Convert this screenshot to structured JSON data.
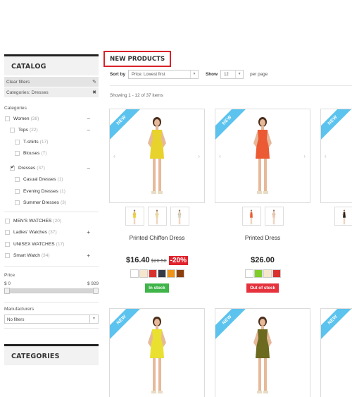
{
  "sidebar": {
    "catalog_title": "CATALOG",
    "clear_filters": "Clear filters",
    "clear_icon": "eraser-icon",
    "active_filter": "Categories: Dresses",
    "remove_icon": "close-icon",
    "categories_label": "Categories",
    "categories": [
      {
        "label": "Women",
        "count": "(38)",
        "level": 1,
        "checked": false,
        "toggle": "−"
      },
      {
        "label": "Tops",
        "count": "(22)",
        "level": 2,
        "checked": false,
        "toggle": "−"
      },
      {
        "label": "T-shirts",
        "count": "(17)",
        "level": 3,
        "checked": false,
        "toggle": ""
      },
      {
        "label": "Blouses",
        "count": "(7)",
        "level": 3,
        "checked": false,
        "toggle": ""
      },
      {
        "label": "Dresses",
        "count": "(37)",
        "level": 2,
        "checked": true,
        "toggle": "−"
      },
      {
        "label": "Casual Dresses",
        "count": "(1)",
        "level": 3,
        "checked": false,
        "toggle": ""
      },
      {
        "label": "Evening Dresses",
        "count": "(1)",
        "level": 3,
        "checked": false,
        "toggle": ""
      },
      {
        "label": "Summer Dresses",
        "count": "(3)",
        "level": 3,
        "checked": false,
        "toggle": ""
      },
      {
        "label": "MEN'S WATCHES",
        "count": "(20)",
        "level": 1,
        "checked": false,
        "toggle": ""
      },
      {
        "label": "Ladies' Watches",
        "count": "(37)",
        "level": 1,
        "checked": false,
        "toggle": "+"
      },
      {
        "label": "UNISEX WATCHES",
        "count": "(17)",
        "level": 1,
        "checked": false,
        "toggle": ""
      },
      {
        "label": "Smart Watch",
        "count": "(34)",
        "level": 1,
        "checked": false,
        "toggle": "+"
      }
    ],
    "price_label": "Price",
    "price_min": "$ 0",
    "price_max": "$ 929",
    "price_slider_range": [
      0,
      929
    ],
    "manufacturers_label": "Manufacturers",
    "manufacturers_value": "No filters",
    "categories_title": "CATEGORIES"
  },
  "main": {
    "title": "NEW PRODUCTS",
    "sort_label": "Sort by",
    "sort_value": "Price: Lowest first",
    "show_label": "Show",
    "show_value": "12",
    "per_page": "per page",
    "showing": "Showing 1 - 12 of 37 items",
    "badge": "NEW",
    "prev_icon": "‹",
    "next_icon": "›",
    "arrow_icon": "▼",
    "products": [
      {
        "name": "Printed Chiffon Dress",
        "price": "$16.40",
        "old_price": "$20.50",
        "reduction": "-20%",
        "colors": [
          "#ffffff",
          "#f5e6cc",
          "#d8312e",
          "#363a47",
          "#ef9419",
          "#8b3f0f"
        ],
        "stock": "In stock",
        "in_stock": true,
        "dress_color": "#e8d22c",
        "thumbs": [
          "#e8d22c",
          "#e6dca0",
          "#cfd6c8"
        ]
      },
      {
        "name": "Printed Dress",
        "price": "$26.00",
        "old_price": "",
        "reduction": "",
        "colors": [
          "#ffffff",
          "#7fcd29",
          "#f5e6cc",
          "#d8312e"
        ],
        "stock": "Out of stock",
        "in_stock": false,
        "dress_color": "#ec5a34",
        "thumbs": [
          "#ec5a34",
          "#e8c7b5"
        ]
      }
    ]
  }
}
